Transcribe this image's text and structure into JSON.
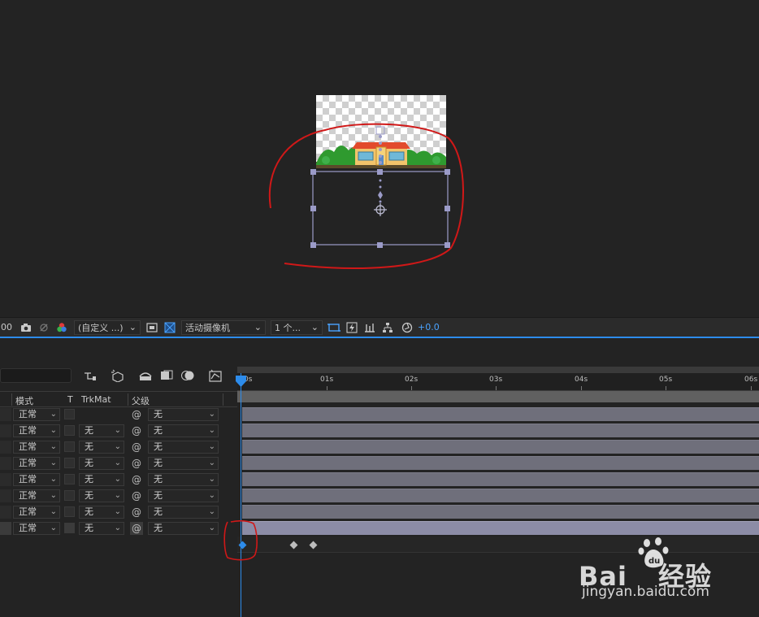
{
  "toolbar": {
    "zoom_fragment": "00",
    "resolution": "(自定义 ...)",
    "camera": "活动摄像机",
    "views": "1 个...",
    "exposure": "+0.0"
  },
  "columns": {
    "mode": "模式",
    "t": "T",
    "trkmat": "TrkMat",
    "parent": "父级"
  },
  "layers": [
    {
      "mode": "正常",
      "trkmat": "",
      "parent": "无"
    },
    {
      "mode": "正常",
      "trkmat": "无",
      "parent": "无"
    },
    {
      "mode": "正常",
      "trkmat": "无",
      "parent": "无"
    },
    {
      "mode": "正常",
      "trkmat": "无",
      "parent": "无"
    },
    {
      "mode": "正常",
      "trkmat": "无",
      "parent": "无"
    },
    {
      "mode": "正常",
      "trkmat": "无",
      "parent": "无"
    },
    {
      "mode": "正常",
      "trkmat": "无",
      "parent": "无"
    },
    {
      "mode": "正常",
      "trkmat": "无",
      "parent": "无"
    }
  ],
  "ruler": {
    "labels": [
      "0s",
      "01s",
      "02s",
      "03s",
      "04s",
      "05s",
      "06s"
    ]
  },
  "watermark": {
    "brand": "Bai",
    "brand2": "经验",
    "url": "jingyan.baidu.com"
  },
  "colors": {
    "accent": "#2d8ceb",
    "annotation": "#d01818",
    "track": "#6f6f7b",
    "track_selected": "#8c8ca6"
  }
}
